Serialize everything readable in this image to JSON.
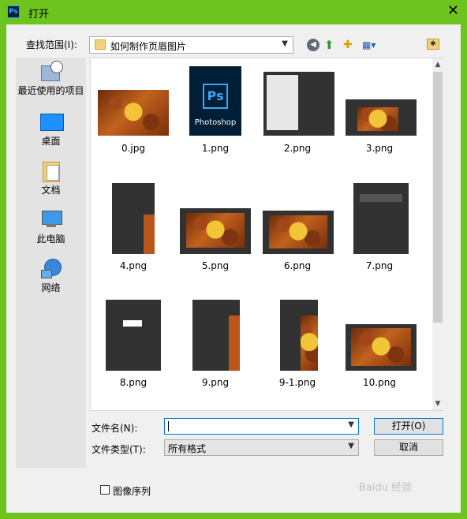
{
  "window": {
    "title": "打开",
    "app_icon": "Ps"
  },
  "toolbar": {
    "look_in_label": "查找范围(I):",
    "look_in_value": "如何制作页眉图片"
  },
  "places": [
    {
      "label": "最近使用的项目",
      "icon": "recent-icon"
    },
    {
      "label": "桌面",
      "icon": "desktop-icon"
    },
    {
      "label": "文档",
      "icon": "documents-icon"
    },
    {
      "label": "此电脑",
      "icon": "computer-icon"
    },
    {
      "label": "网络",
      "icon": "network-icon"
    }
  ],
  "files": [
    {
      "name": "0.jpg"
    },
    {
      "name": "1.png"
    },
    {
      "name": "2.png"
    },
    {
      "name": "3.png"
    },
    {
      "name": "4.png"
    },
    {
      "name": "5.png"
    },
    {
      "name": "6.png"
    },
    {
      "name": "7.png"
    },
    {
      "name": "8.png"
    },
    {
      "name": "9.png"
    },
    {
      "name": "9-1.png"
    },
    {
      "name": "10.png"
    }
  ],
  "thumb_text": {
    "photoshop": "Photoshop",
    "ps": "Ps"
  },
  "form": {
    "file_name_label": "文件名(N):",
    "file_name_value": "",
    "file_type_label": "文件类型(T):",
    "file_type_value": "所有格式",
    "open_label": "打开(O)",
    "cancel_label": "取消",
    "image_sequence_label": "图像序列"
  },
  "watermark": "Baidu 经验"
}
